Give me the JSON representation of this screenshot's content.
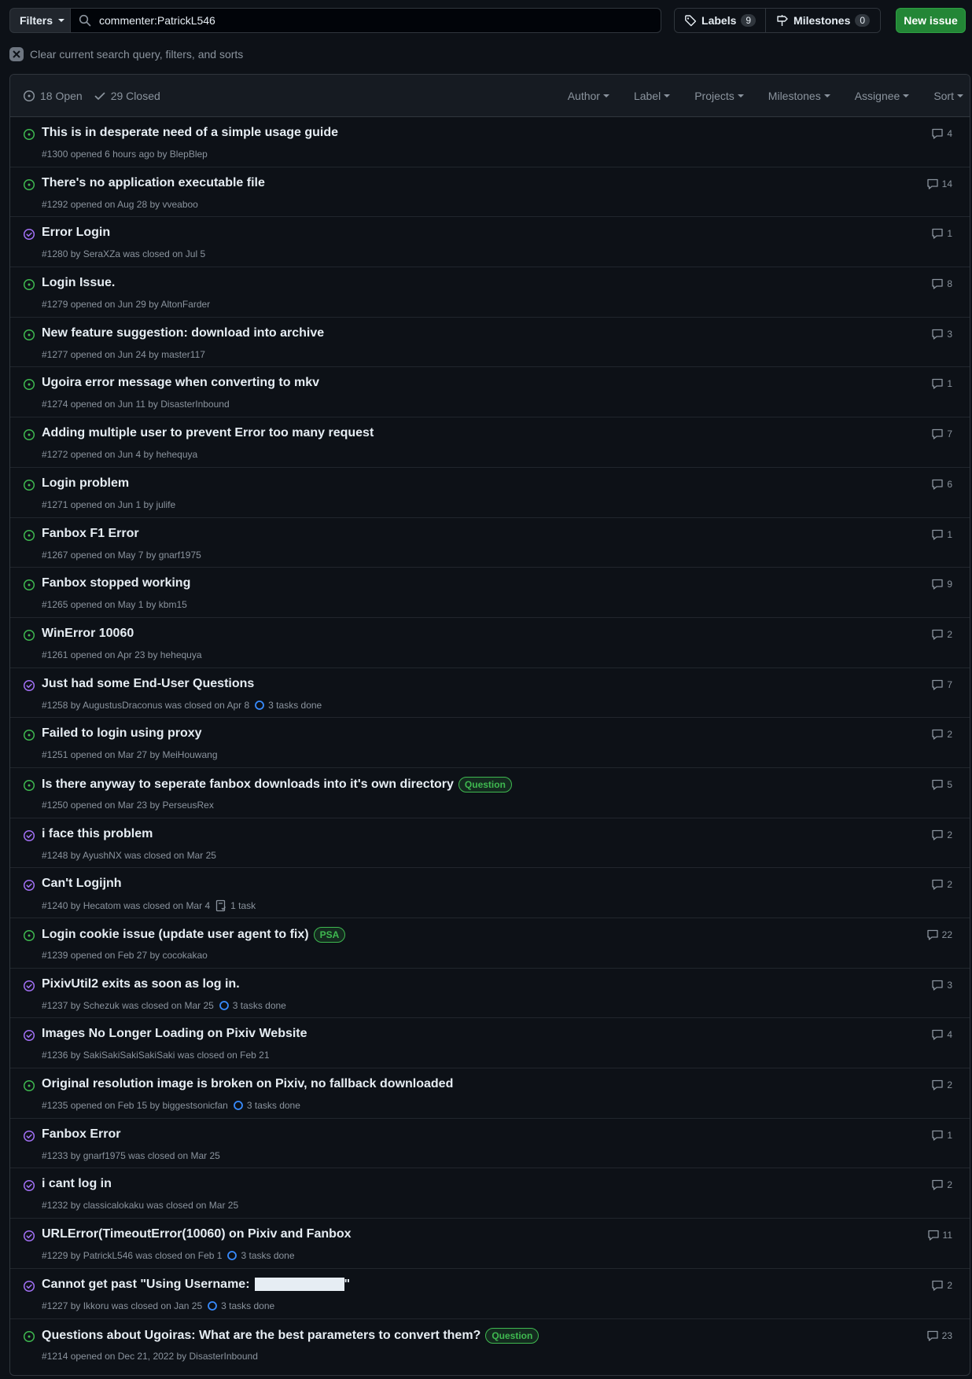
{
  "topbar": {
    "filters_label": "Filters",
    "search_value": "commenter:PatrickL546",
    "labels_label": "Labels",
    "labels_count": "9",
    "milestones_label": "Milestones",
    "milestones_count": "0",
    "new_issue_label": "New issue"
  },
  "clear_text": "Clear current search query, filters, and sorts",
  "header": {
    "open_label": "18 Open",
    "closed_label": "29 Closed",
    "sorts": [
      "Author",
      "Label",
      "Projects",
      "Milestones",
      "Assignee",
      "Sort"
    ]
  },
  "colors": {
    "open": "#3fb950",
    "closed": "#a371f7",
    "task": "#388bfd",
    "label_green": "#3fb950"
  },
  "issues": [
    {
      "state": "open",
      "title": "This is in desperate need of a simple usage guide",
      "meta": "#1300 opened 6 hours ago by BlepBlep",
      "comments": "4"
    },
    {
      "state": "open",
      "title": "There's no application executable file",
      "meta": "#1292 opened on Aug 28 by vveaboo",
      "comments": "14"
    },
    {
      "state": "closed",
      "title": "Error Login",
      "meta": "#1280 by SeraXZa was closed on Jul 5",
      "comments": "1"
    },
    {
      "state": "open",
      "title": "Login Issue.",
      "meta": "#1279 opened on Jun 29 by AltonFarder",
      "comments": "8"
    },
    {
      "state": "open",
      "title": "New feature suggestion: download into archive",
      "meta": "#1277 opened on Jun 24 by master117",
      "comments": "3"
    },
    {
      "state": "open",
      "title": "Ugoira error message when converting to mkv",
      "meta": "#1274 opened on Jun 11 by DisasterInbound",
      "comments": "1"
    },
    {
      "state": "open",
      "title": "Adding multiple user to prevent Error too many request",
      "meta": "#1272 opened on Jun 4 by hehequya",
      "comments": "7"
    },
    {
      "state": "open",
      "title": "Login problem",
      "meta": "#1271 opened on Jun 1 by julife",
      "comments": "6"
    },
    {
      "state": "open",
      "title": "Fanbox F1 Error",
      "meta": "#1267 opened on May 7 by gnarf1975",
      "comments": "1"
    },
    {
      "state": "open",
      "title": "Fanbox stopped working",
      "meta": "#1265 opened on May 1 by kbm15",
      "comments": "9"
    },
    {
      "state": "open",
      "title": "WinError 10060",
      "meta": "#1261 opened on Apr 23 by hehequya",
      "comments": "2"
    },
    {
      "state": "closed",
      "title": "Just had some End-User Questions",
      "meta": "#1258 by AugustusDraconus was closed on Apr 8",
      "task": "3 tasks done",
      "task_type": "done",
      "comments": "7"
    },
    {
      "state": "open",
      "title": "Failed to login using proxy",
      "meta": "#1251 opened on Mar 27 by MeiHouwang",
      "comments": "2"
    },
    {
      "state": "open",
      "title": "Is there anyway to seperate fanbox downloads into it's own directory",
      "label": "Question",
      "meta": "#1250 opened on Mar 23 by PerseusRex",
      "comments": "5"
    },
    {
      "state": "closed",
      "title": "i face this problem",
      "meta": "#1248 by AyushNX was closed on Mar 25",
      "comments": "2"
    },
    {
      "state": "closed",
      "title": "Can't Logijnh",
      "meta": "#1240 by Hecatom was closed on Mar 4",
      "task": "1 task",
      "task_type": "list",
      "comments": "2"
    },
    {
      "state": "open",
      "title": "Login cookie issue (update user agent to fix)",
      "label": "PSA",
      "meta": "#1239 opened on Feb 27 by cocokakao",
      "comments": "22"
    },
    {
      "state": "closed",
      "title": "PixivUtil2 exits as soon as log in.",
      "meta": "#1237 by Schezuk was closed on Mar 25",
      "task": "3 tasks done",
      "task_type": "done",
      "comments": "3"
    },
    {
      "state": "closed",
      "title": "Images No Longer Loading on Pixiv Website",
      "meta": "#1236 by SakiSakiSakiSakiSaki was closed on Feb 21",
      "comments": "4"
    },
    {
      "state": "open",
      "title": "Original resolution image is broken on Pixiv, no fallback downloaded",
      "meta": "#1235 opened on Feb 15 by biggestsonicfan",
      "task": "3 tasks done",
      "task_type": "done",
      "comments": "2"
    },
    {
      "state": "closed",
      "title": "Fanbox Error",
      "meta": "#1233 by gnarf1975 was closed on Mar 25",
      "comments": "1"
    },
    {
      "state": "closed",
      "title": "i cant log in",
      "meta": "#1232 by classicalokaku was closed on Mar 25",
      "comments": "2"
    },
    {
      "state": "closed",
      "title": "URLError(TimeoutError(10060) on Pixiv and Fanbox",
      "meta": "#1229 by PatrickL546 was closed on Feb 1",
      "task": "3 tasks done",
      "task_type": "done",
      "comments": "11"
    },
    {
      "state": "closed",
      "title": "Cannot get past \"Using Username:",
      "title_suffix": "\"",
      "redacted": true,
      "meta": "#1227 by Ikkoru was closed on Jan 25",
      "task": "3 tasks done",
      "task_type": "done",
      "comments": "2"
    },
    {
      "state": "open",
      "title": "Questions about Ugoiras: What are the best parameters to convert them?",
      "label": "Question",
      "meta": "#1214 opened on Dec 21, 2022 by DisasterInbound",
      "comments": "23"
    }
  ]
}
